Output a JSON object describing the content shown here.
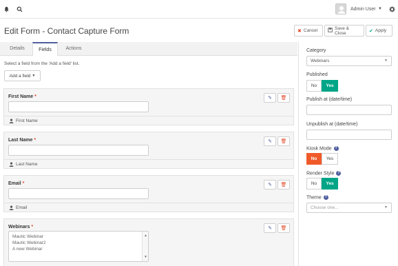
{
  "topbar": {
    "user_name": "Admin User",
    "icons": [
      "bell-icon",
      "search-icon",
      "gear-icon"
    ]
  },
  "header": {
    "title": "Edit Form - Contact Capture Form",
    "cancel_label": "Cancel",
    "save_close_label": "Save & Close",
    "apply_label": "Apply"
  },
  "tabs": [
    {
      "label": "Details",
      "active": false
    },
    {
      "label": "Fields",
      "active": true
    },
    {
      "label": "Actions",
      "active": false
    }
  ],
  "fields_tab": {
    "hint": "Select a field from the 'Add a field' list.",
    "add_field_label": "Add a field",
    "fields": [
      {
        "label": "First Name",
        "required_mark": "*",
        "footer": "First Name"
      },
      {
        "label": "Last Name",
        "required_mark": "*",
        "footer": "Last Name"
      },
      {
        "label": "Email",
        "required_mark": "*",
        "footer": "Email"
      },
      {
        "label": "Webinars",
        "required_mark": "*",
        "options": [
          "Mautic Webinar",
          "Mautic Webinar2",
          "A new Webinar"
        ]
      }
    ]
  },
  "sidebar": {
    "category_label": "Category",
    "category_value": "Webinars",
    "published_label": "Published",
    "published": {
      "no": "No",
      "yes": "Yes",
      "selected": "Yes"
    },
    "publish_at_label": "Publish at (date/time)",
    "unpublish_at_label": "Unpublish at (date/time)",
    "kiosk_label": "Kiosk Mode",
    "kiosk": {
      "no": "No",
      "yes": "Yes",
      "selected": "No"
    },
    "render_label": "Render Style",
    "render": {
      "no": "No",
      "yes": "Yes",
      "selected": "Yes"
    },
    "theme_label": "Theme",
    "theme_placeholder": "Choose one..."
  },
  "colors": {
    "accent": "#4e5d9d",
    "success": "#00a587",
    "danger": "#f05a2a"
  }
}
